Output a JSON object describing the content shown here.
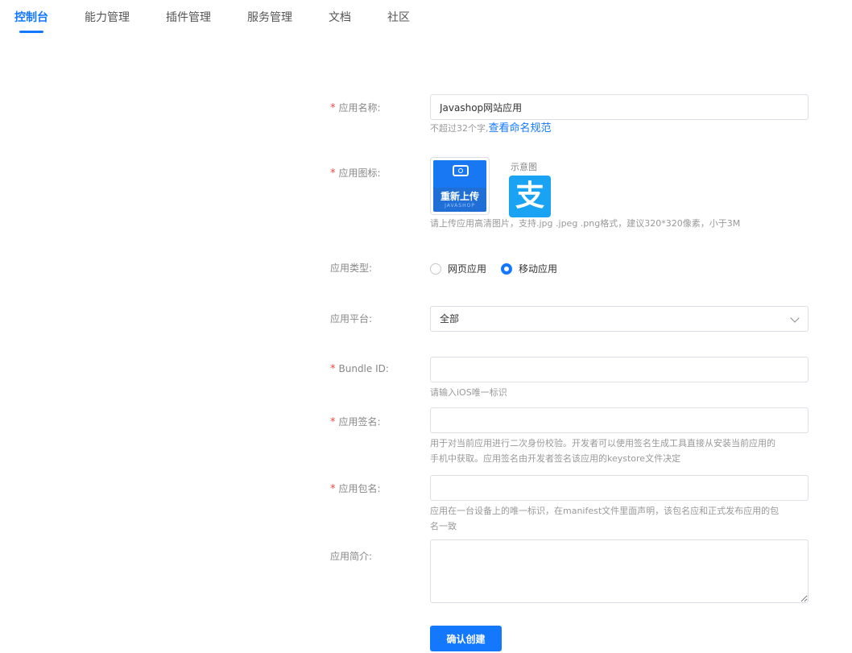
{
  "nav": {
    "tabs": [
      "控制台",
      "能力管理",
      "插件管理",
      "服务管理",
      "文档",
      "社区"
    ],
    "active_index": 0
  },
  "form": {
    "app_name": {
      "label": "应用名称:",
      "value": "Javashop网站应用",
      "hint": "不超过32个字,",
      "hint_link": "查看命名规范"
    },
    "app_icon": {
      "label": "应用图标:",
      "upload_label": "重新上传",
      "upload_brand": "JAVASHOP",
      "sample_label": "示意图",
      "sample_glyph": "支",
      "hint": "请上传应用高清图片，支持.jpg .jpeg .png格式，建议320*320像素，小于3M"
    },
    "app_type": {
      "label": "应用类型:",
      "options": [
        "网页应用",
        "移动应用"
      ],
      "selected_index": 1
    },
    "platform": {
      "label": "应用平台:",
      "value": "全部"
    },
    "bundle_id": {
      "label": "Bundle ID:",
      "value": "",
      "hint": "请输入iOS唯一标识"
    },
    "signature": {
      "label": "应用签名:",
      "value": "",
      "hint_line1": "用于对当前应用进行二次身份校验。开发者可以使用签名生成工具直接从安装当前应用的",
      "hint_line2": "手机中获取。应用签名由开发者签名该应用的keystore文件决定"
    },
    "package": {
      "label": "应用包名:",
      "value": "",
      "hint_line1": "应用在一台设备上的唯一标识，在manifest文件里面声明，该包名应和正式发布应用的包",
      "hint_line2": "名一致"
    },
    "description": {
      "label": "应用简介:",
      "value": ""
    },
    "submit_label": "确认创建"
  },
  "colors": {
    "accent": "#1478ff",
    "required": "#f5453f"
  }
}
